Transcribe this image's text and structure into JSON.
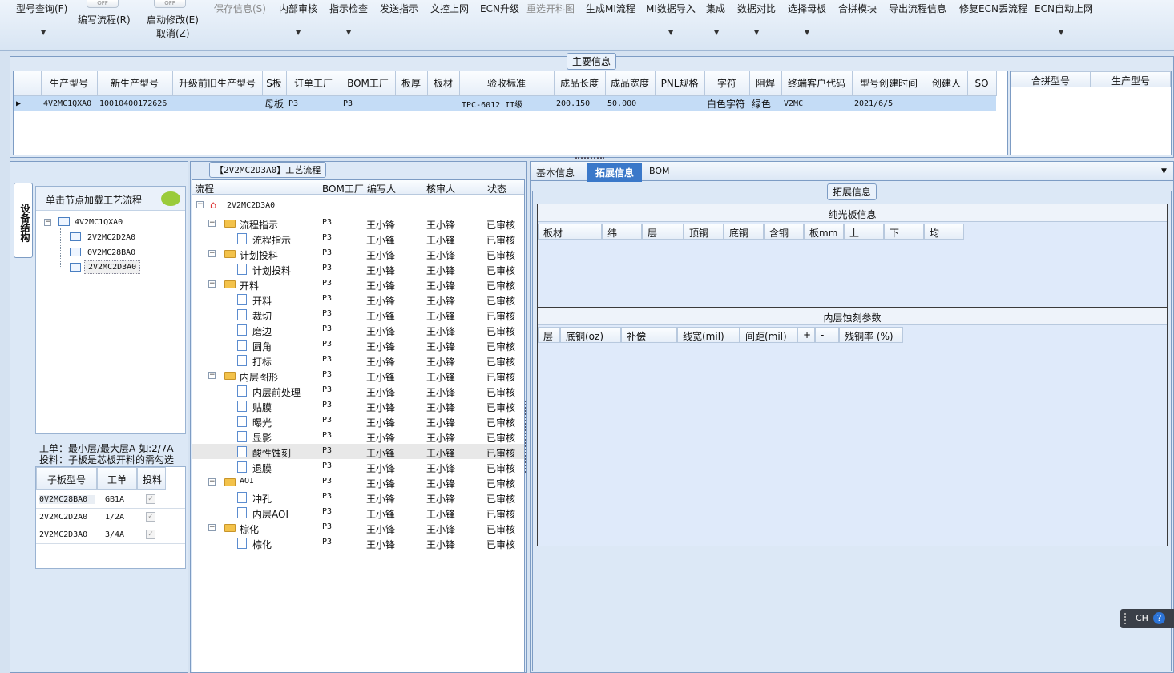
{
  "toolbar": {
    "items": [
      "型号查询(F)",
      "编写流程(R)",
      "启动修改(E)",
      "取消(Z)",
      "保存信息(S)",
      "内部审核",
      "指示检查",
      "发送指示",
      "文控上网",
      "ECN升级",
      "重选开料图",
      "生成MI流程",
      "MI数据导入",
      "集成",
      "数据对比",
      "选择母板",
      "合拼模块",
      "导出流程信息",
      "修复ECN丢流程",
      "ECN自动上网"
    ],
    "toggle_text": "OFF"
  },
  "main_info": {
    "caption": "主要信息",
    "headers": [
      "生产型号",
      "新生产型号",
      "升级前旧生产型号",
      "S板",
      "订单工厂",
      "BOM工厂",
      "板厚",
      "板材",
      "验收标准",
      "成品长度",
      "成品宽度",
      "PNL规格",
      "字符",
      "阻焊",
      "终端客户代码",
      "型号创建时间",
      "创建人",
      "SO"
    ],
    "row": [
      "4V2MC1QXA0",
      "10010400172626",
      "",
      "母板",
      "P3",
      "P3",
      "",
      "",
      "IPC-6012 II级",
      "200.150",
      "50.000",
      "",
      "白色字符",
      "绿色",
      "V2MC",
      "2021/6/5",
      "",
      ""
    ],
    "merge_headers": [
      "合拼型号",
      "生产型号"
    ]
  },
  "left": {
    "vertical_tab": "设备结构",
    "hint": "单击节点加载工艺流程",
    "tree": [
      "4V2MC1QXA0",
      "2V2MC2D2A0",
      "0V2MC28BA0",
      "2V2MC2D3A0"
    ],
    "note1": "工单：最小层/最大层A 如:2/7A",
    "note2": "投料：子板是芯板开料的需勾选",
    "sub_headers": [
      "子板型号",
      "工单",
      "投料"
    ],
    "sub_rows": [
      [
        "0V2MC28BA0",
        "GB1A"
      ],
      [
        "2V2MC2D2A0",
        "1/2A"
      ],
      [
        "2V2MC2D3A0",
        "3/4A"
      ]
    ]
  },
  "flow": {
    "caption": "【2V2MC2D3A0】工艺流程",
    "headers": [
      "流程",
      "BOM工厂",
      "编写人",
      "核审人",
      "状态"
    ],
    "root": "2V2MC2D3A0",
    "rows": [
      {
        "name": "流程指示",
        "lvl": 1
      },
      {
        "name": "流程指示",
        "lvl": 2
      },
      {
        "name": "计划投料",
        "lvl": 1
      },
      {
        "name": "计划投料",
        "lvl": 2
      },
      {
        "name": "开料",
        "lvl": 1
      },
      {
        "name": "开料",
        "lvl": 2
      },
      {
        "name": "裁切",
        "lvl": 2
      },
      {
        "name": "磨边",
        "lvl": 2
      },
      {
        "name": "圆角",
        "lvl": 2
      },
      {
        "name": "打标",
        "lvl": 2
      },
      {
        "name": "内层图形",
        "lvl": 1
      },
      {
        "name": "内层前处理",
        "lvl": 2
      },
      {
        "name": "贴膜",
        "lvl": 2
      },
      {
        "name": "曝光",
        "lvl": 2
      },
      {
        "name": "显影",
        "lvl": 2
      },
      {
        "name": "酸性蚀刻",
        "lvl": 2
      },
      {
        "name": "退膜",
        "lvl": 2
      },
      {
        "name": "AOI",
        "lvl": 1
      },
      {
        "name": "冲孔",
        "lvl": 2
      },
      {
        "name": "内层AOI",
        "lvl": 2
      },
      {
        "name": "棕化",
        "lvl": 1
      },
      {
        "name": "棕化",
        "lvl": 2
      }
    ],
    "bom": "P3",
    "writer": "王小锋",
    "reviewer": "王小锋",
    "status": "已审核"
  },
  "right": {
    "tabs": [
      "基本信息",
      "拓展信息",
      "BOM"
    ],
    "caption": "拓展信息",
    "g1_title": "纯光板信息",
    "g1_headers": [
      "板材",
      "纬",
      "层",
      "顶铜",
      "底铜",
      "含铜",
      "板mm",
      "上",
      "下",
      "均"
    ],
    "g2_title": "内层蚀刻参数",
    "g2_headers": [
      "层",
      "底铜(oz)",
      "补偿",
      "线宽(mil)",
      "间距(mil)",
      "+",
      "-",
      "残铜率 (%)"
    ]
  },
  "ime": {
    "label": "CH"
  }
}
